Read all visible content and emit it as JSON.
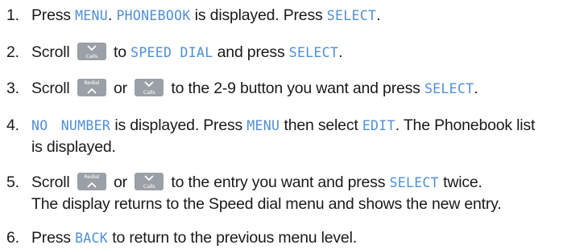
{
  "steps": [
    {
      "number": "1.",
      "t1": "Press",
      "lcd1": "MENU",
      "t2": ".",
      "lcd2": "PHONEBOOK",
      "t3": "is displayed. Press",
      "lcd3": "SELECT",
      "t4": "."
    },
    {
      "number": "2.",
      "t1": "Scroll",
      "t2": "to",
      "lcd1": "SPEED DIAL",
      "t3": "and press",
      "lcd2": "SELECT",
      "t4": "."
    },
    {
      "number": "3.",
      "t1": "Scroll",
      "t2": "or",
      "t3": "to the 2-9 button you want and press",
      "lcd1": "SELECT",
      "t4": "."
    },
    {
      "number": "4.",
      "lcd1": "NO NUMBER",
      "t1": "is displayed. Press",
      "lcd2": "MENU",
      "t2": "then select",
      "lcd3": "EDIT",
      "t3": ". The Phonebook list",
      "line2": "is displayed."
    },
    {
      "number": "5.",
      "t1": "Scroll",
      "t2": "or",
      "t3": "to the entry you want and press",
      "lcd1": "SELECT",
      "t4": "twice.",
      "line2": "The display returns to the Speed dial menu and shows the new entry."
    },
    {
      "number": "6.",
      "t1": "Press",
      "lcd1": "BACK",
      "t2": "to return to the previous menu level."
    }
  ],
  "keys": {
    "calls_label": "Calls",
    "redial_label": "Redial",
    "color": "#9aa0a6"
  },
  "colors": {
    "lcd_text": "#4f8fd6",
    "body_text": "#1a1a1a"
  }
}
